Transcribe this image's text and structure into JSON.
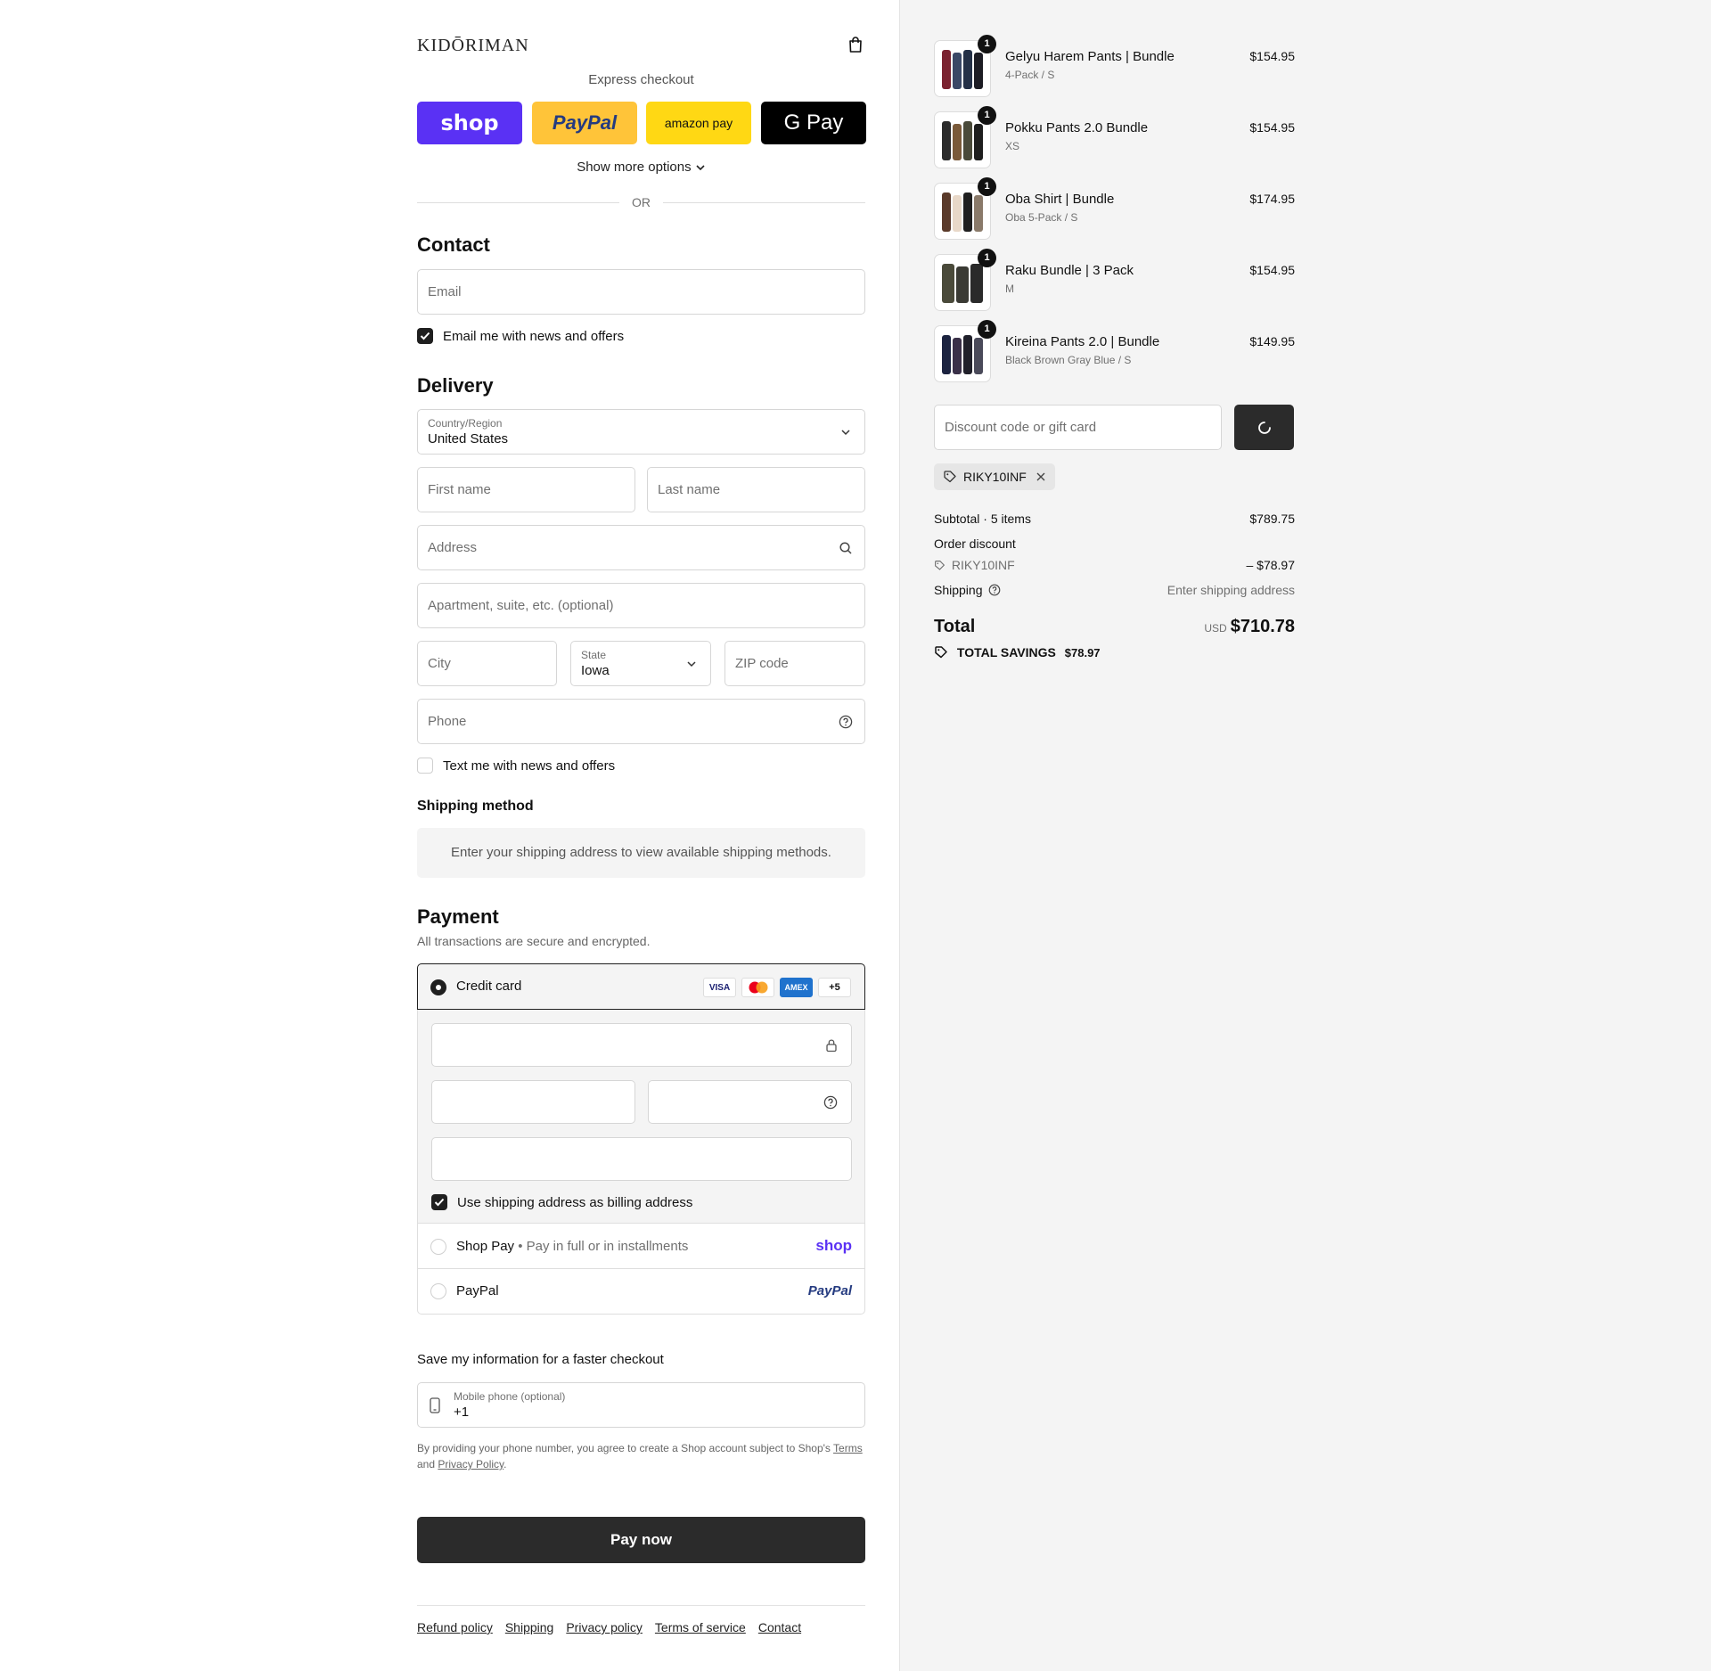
{
  "brand": {
    "logo_text": "KIDŌRIMAN"
  },
  "express": {
    "label": "Express checkout",
    "buttons": [
      {
        "name": "shop",
        "label": "shop",
        "bg": "#5a31f4"
      },
      {
        "name": "paypal",
        "label": "PayPal",
        "bg": "#ffc439"
      },
      {
        "name": "amazon-pay",
        "label": "amazon pay",
        "bg": "#ffd814"
      },
      {
        "name": "google-pay",
        "label": "G Pay",
        "bg": "#000000"
      }
    ],
    "more_options": "Show more options",
    "or": "OR"
  },
  "contact": {
    "title": "Contact",
    "email_placeholder": "Email",
    "news_checkbox": "Email me with news and offers"
  },
  "delivery": {
    "title": "Delivery",
    "country_label": "Country/Region",
    "country_value": "United States",
    "first_name": "First name",
    "last_name": "Last name",
    "address": "Address",
    "apartment": "Apartment, suite, etc. (optional)",
    "city": "City",
    "state_label": "State",
    "state_value": "Iowa",
    "zip": "ZIP code",
    "phone": "Phone",
    "text_checkbox": "Text me with news and offers"
  },
  "shipping_method": {
    "title": "Shipping method",
    "message": "Enter your shipping address to view available shipping methods."
  },
  "payment": {
    "title": "Payment",
    "subtitle": "All transactions are secure and encrypted.",
    "credit_card": "Credit card",
    "card_logos": [
      "VISA",
      "MC",
      "AMEX",
      "+5"
    ],
    "billing_checkbox": "Use shipping address as billing address",
    "shop_pay": "Shop Pay",
    "shop_pay_sub": "Pay in full or in installments",
    "shop_pay_logo": "shop",
    "paypal": "PayPal",
    "paypal_logo": "PayPal"
  },
  "save_info": {
    "title": "Save my information for a faster checkout",
    "mobile_label": "Mobile phone (optional)",
    "mobile_value": "+1",
    "legal_pre": "By providing your phone number, you agree to create a Shop account subject to Shop's",
    "terms": "Terms",
    "and": "and",
    "privacy": "Privacy Policy"
  },
  "pay_now": "Pay now",
  "footer": [
    "Refund policy",
    "Shipping",
    "Privacy policy",
    "Terms of service",
    "Contact"
  ],
  "cart": {
    "items": [
      {
        "name": "Gelyu Harem Pants | Bundle",
        "variant": "4-Pack / S",
        "price": "$154.95",
        "qty": "1",
        "colors": [
          "#7a2230",
          "#3a4866",
          "#243047",
          "#1c1c24"
        ]
      },
      {
        "name": "Pokku Pants 2.0 Bundle",
        "variant": "XS",
        "price": "$154.95",
        "qty": "1",
        "colors": [
          "#2b2b2b",
          "#7a5a3a",
          "#4a4a3a",
          "#1e1e1e"
        ]
      },
      {
        "name": "Oba Shirt | Bundle",
        "variant": "Oba 5-Pack / S",
        "price": "$174.95",
        "qty": "1",
        "colors": [
          "#5a3a2a",
          "#e8d8c8",
          "#1f1f1f",
          "#8a7a6a"
        ]
      },
      {
        "name": "Raku Bundle | 3 Pack",
        "variant": "M",
        "price": "$154.95",
        "qty": "1",
        "colors": [
          "#4a4a3a",
          "#3a3a34",
          "#2a2a2a"
        ]
      },
      {
        "name": "Kireina Pants 2.0 | Bundle",
        "variant": "Black Brown Gray Blue / S",
        "price": "$149.95",
        "qty": "1",
        "colors": [
          "#1c2340",
          "#3a3048",
          "#20202a",
          "#4a4a5a"
        ]
      }
    ],
    "discount_placeholder": "Discount code or gift card",
    "applied_code": "RIKY10INF",
    "subtotal_label": "Subtotal · 5 items",
    "subtotal_value": "$789.75",
    "order_discount_label": "Order discount",
    "discount_code": "RIKY10INF",
    "discount_value": "– $78.97",
    "shipping_label": "Shipping",
    "shipping_value": "Enter shipping address",
    "total_label": "Total",
    "currency": "USD",
    "total_value": "$710.78",
    "savings_label": "TOTAL SAVINGS",
    "savings_value": "$78.97"
  }
}
